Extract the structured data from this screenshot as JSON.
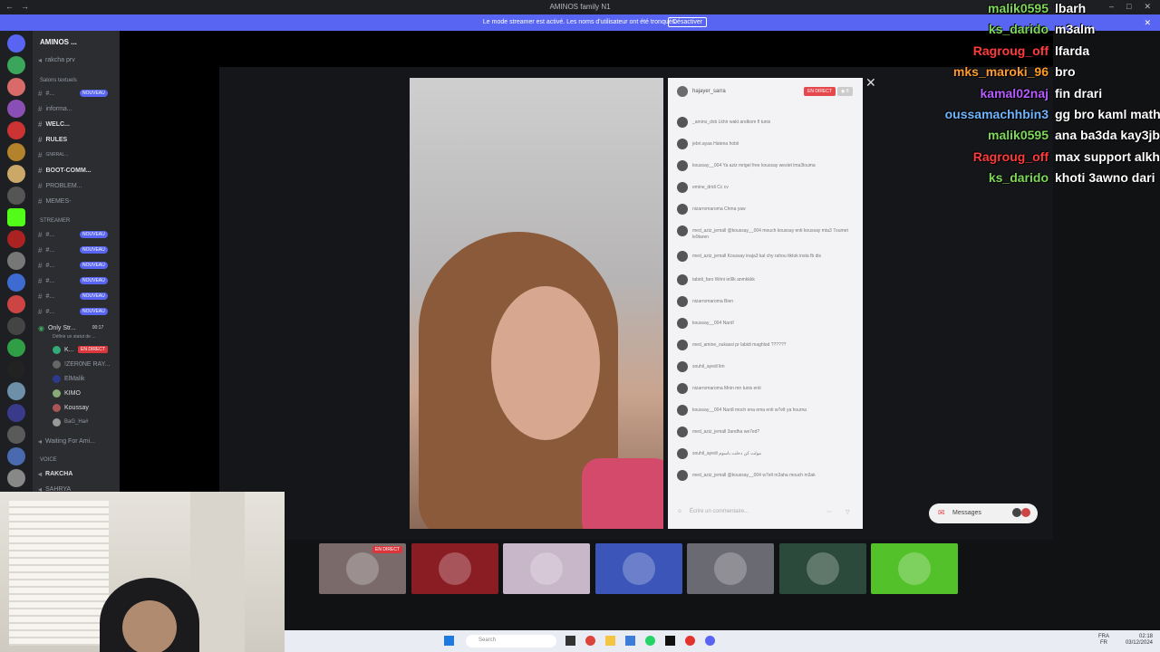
{
  "window": {
    "title": "AMINOS family N1",
    "minimize_icon": "minimize-icon",
    "maximize_icon": "maximize-icon",
    "close_icon": "close-icon"
  },
  "banner": {
    "text": "Le mode streamer est activé. Les noms d'utilisateur ont été tronqués.",
    "button": "Désactiver",
    "color": "#5865f2"
  },
  "sidebar": {
    "server_name": "AMINOS ...",
    "top_item": "rakcha prv",
    "section_text": "Salons textuels",
    "text_channels": [
      {
        "label": "#...",
        "badge": "NOUVEAU"
      },
      {
        "label": "informa...",
        "badge": ""
      },
      {
        "label": "WELC...",
        "badge": ""
      },
      {
        "label": "RULES",
        "badge": ""
      },
      {
        "label": "GNRRAL...",
        "badge": ""
      },
      {
        "label": "BOOT-COMM...",
        "badge": ""
      },
      {
        "label": "PROBLEM...",
        "badge": ""
      },
      {
        "label": "MEMES-",
        "badge": ""
      }
    ],
    "section_streamer": "STREAMER",
    "streamer_channels": [
      {
        "label": "#...",
        "badge": "NOUVEAU"
      },
      {
        "label": "#...",
        "badge": "NOUVEAU"
      },
      {
        "label": "#...",
        "badge": "NOUVEAU"
      },
      {
        "label": "#...",
        "badge": "NOUVEAU"
      },
      {
        "label": "#...",
        "badge": "NOUVEAU"
      },
      {
        "label": "#...",
        "badge": "NOUVEAU"
      }
    ],
    "voice_channel": "Only Str...",
    "voice_time": "00:17",
    "voice_sub": "Définir un statut de ...",
    "voice_users": [
      "K...",
      "!ZER0NE RAY...",
      "ElMalik",
      "KIMO",
      "Koussay",
      "BaG_Ha#"
    ],
    "live_badge": "EN DIRECT",
    "waiting_channel": "Waiting For Ami...",
    "voice_section": "VOICE",
    "rakcha_channel": "RAKCHA",
    "sahrya_channel": "SAHRYA"
  },
  "live_chat": {
    "header_user": "hajayer_sarra",
    "live_badge": "EN DIRECT",
    "viewers": "8",
    "messages": [
      {
        "text": "_amino_dxb Lkhir wakt andkom fl tunis"
      },
      {
        "text": "jebri.ayaa Hatena hobii"
      },
      {
        "text": "koussay__004 Ya aziz mrigel free koussay weslet lma3louma"
      },
      {
        "text": "emine_dridi Cc cv"
      },
      {
        "text": "nizarromaroma Chma yaw"
      },
      {
        "text": "med_aziz_jemall @koussay__004 mouch koussay enti koussay mta3 7oumet le9taren"
      },
      {
        "text": "med_aziz_jemall Koussay inaja3 kal chy rahou tiktok insta fb dis"
      },
      {
        "text": "tabidi_faro Wrini ie9lk anmkkkk"
      },
      {
        "text": "nizarromaroma Bien"
      },
      {
        "text": "koussay__004 Nard!"
      },
      {
        "text": "med_amine_oukassi pr labidi maghlod ??????"
      },
      {
        "text": "souhil_ayedi lim"
      },
      {
        "text": "nizarromaroma Mnin mn tunis enti"
      },
      {
        "text": "koussay__004 Nardl moch ena ema enti w7elt ya houma"
      },
      {
        "text": "med_aziz_jemall 3andha we7ed?"
      },
      {
        "text": "souhil_ayedi مولت كن دخلت باسوم"
      },
      {
        "text": "med_aziz_jemall @koussay__004 w7elt m3aha mouch m3ak"
      }
    ],
    "input_placeholder": "Écrire un commentaire..."
  },
  "messages_pill": {
    "label": "Messages"
  },
  "stream_thumbnails": [
    {
      "name": "thumb-live-stream",
      "color": "#7a6a6a",
      "badge": "EN DIRECT"
    },
    {
      "name": "thumb-red-avatar",
      "color": "#8a1d24",
      "badge": ""
    },
    {
      "name": "thumb-anime-avatar",
      "color": "#c8b6c9",
      "badge": ""
    },
    {
      "name": "thumb-blue-avatar",
      "color": "#3b55b8",
      "badge": ""
    },
    {
      "name": "thumb-grey-avatar",
      "color": "#6a6a72",
      "badge": ""
    },
    {
      "name": "thumb-cartoon-avatar",
      "color": "#2b4a3b",
      "badge": ""
    },
    {
      "name": "thumb-kick-avatar",
      "color": "#53c22a",
      "badge": ""
    }
  ],
  "kick_chat": [
    {
      "user": "malik0595",
      "msg": "lbarh",
      "color": "#7dd957"
    },
    {
      "user": "ks_darido",
      "msg": "m3alm",
      "color": "#7dd957"
    },
    {
      "user": "Ragroug_off",
      "msg": "lfarda",
      "color": "#ff3b3b"
    },
    {
      "user": "mks_maroki_96",
      "msg": "bro",
      "color": "#ff9b2a"
    },
    {
      "user": "kamal02naj",
      "msg": "fin drari",
      "color": "#b65cff"
    },
    {
      "user": "oussamachhbin3",
      "msg": "gg bro kaml math",
      "color": "#6fb6ff"
    },
    {
      "user": "malik0595",
      "msg": "ana ba3da kay3jb",
      "color": "#7dd957"
    },
    {
      "user": "Ragroug_off",
      "msg": "max support alkh",
      "color": "#ff3b3b"
    },
    {
      "user": "ks_darido",
      "msg": "khoti 3awno dari",
      "color": "#7dd957"
    }
  ],
  "taskbar": {
    "search_placeholder": "Search",
    "lang_line1": "FRA",
    "lang_line2": "FR",
    "time": "02:18",
    "date": "03/12/2024"
  }
}
